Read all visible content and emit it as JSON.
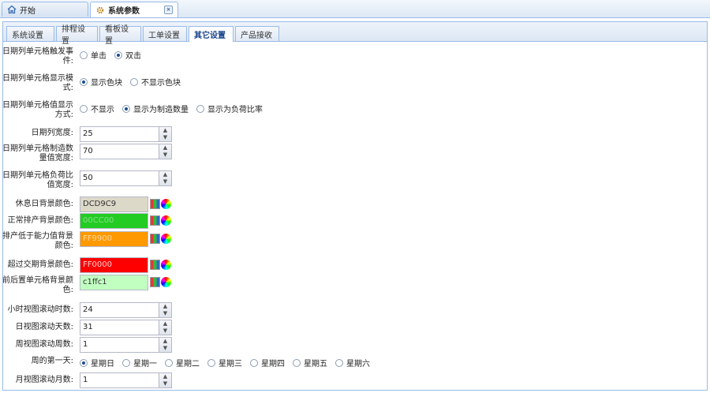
{
  "top_tabs": [
    {
      "label": "开始",
      "icon": "home-icon"
    },
    {
      "label": "系统参数",
      "icon": "gear-icon",
      "close": "×"
    }
  ],
  "sub_tabs": [
    "系统设置",
    "排程设置",
    "看板设置",
    "工单设置",
    "其它设置",
    "产品接收"
  ],
  "active_sub_tab": "其它设置",
  "form": {
    "cell_event": {
      "label": "日期列单元格触发事件:",
      "options": [
        "单击",
        "双击"
      ],
      "selected": 1
    },
    "cell_display": {
      "label": "日期列单元格显示模式:",
      "options": [
        "显示色块",
        "不显示色块"
      ],
      "selected": 0
    },
    "cell_value": {
      "label": "日期列单元格值显示方式:",
      "options": [
        "不显示",
        "显示为制造数量",
        "显示为负荷比率"
      ],
      "selected": 1
    },
    "date_col_width": {
      "label": "日期列宽度:",
      "value": "25"
    },
    "mfg_qty_width": {
      "label": "日期列单元格制造数量值宽度:",
      "value": "70"
    },
    "load_ratio_width": {
      "label": "日期列单元格负荷比值宽度:",
      "value": "50"
    },
    "rest_day_color": {
      "label": "休息日背景颜色:",
      "value": "DCD9C9",
      "bg": "#DCD9C9",
      "fg": "#333333"
    },
    "normal_color": {
      "label": "正常排产背景颜色:",
      "value": "00CC00",
      "bg": "#22CC22",
      "fg": "#88DD88"
    },
    "low_capacity_color": {
      "label": "排产低于能力值背景颜色:",
      "value": "FF9900",
      "bg": "#FF9900",
      "fg": "#FFD9A0"
    },
    "overdue_color": {
      "label": "超过交期背景颜色:",
      "value": "FF0000",
      "bg": "#FF0000",
      "fg": "#FFD0D0"
    },
    "prev_cell_color": {
      "label": "前后置单元格背景颜色:",
      "value": "c1ffc1",
      "bg": "#C1FFC1",
      "fg": "#333333"
    },
    "hour_view_hours": {
      "label": "小时视图滚动时数:",
      "value": "24"
    },
    "day_view_days": {
      "label": "日视图滚动天数:",
      "value": "31"
    },
    "week_view_weeks": {
      "label": "周视图滚动周数:",
      "value": "1"
    },
    "week_start": {
      "label": "周的第一天:",
      "options": [
        "星期日",
        "星期一",
        "星期二",
        "星期三",
        "星期四",
        "星期五",
        "星期六"
      ],
      "selected": 0
    },
    "month_view_months": {
      "label": "月视图滚动月数:",
      "value": "1"
    }
  }
}
